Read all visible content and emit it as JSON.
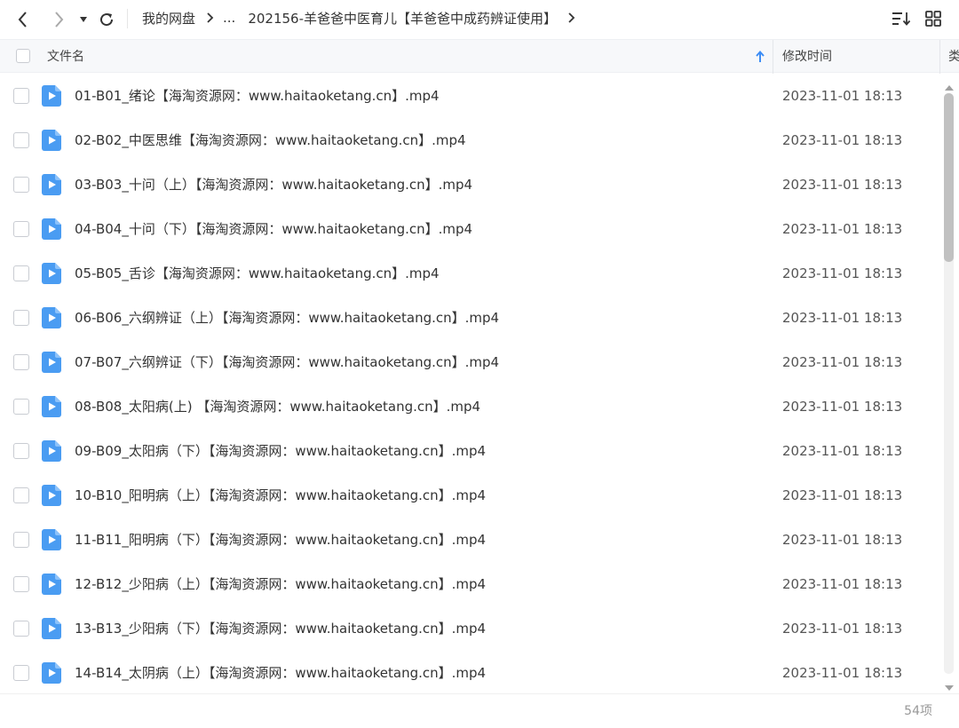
{
  "breadcrumb": {
    "items": [
      "我的网盘",
      "...",
      "202156-羊爸爸中医育儿【羊爸爸中成药辨证使用】"
    ]
  },
  "icons": {
    "back": "chevron-left-icon",
    "forward": "chevron-right-icon",
    "dropdown": "caret-down-icon",
    "refresh": "refresh-icon",
    "sort": "sort-list-icon",
    "grid": "grid-view-icon",
    "file": "video-file-icon"
  },
  "colors": {
    "accent": "#3d8df5",
    "file_icon": "#4a9cf2"
  },
  "header": {
    "name_label": "文件名",
    "time_label": "修改时间",
    "type_label": "类"
  },
  "files": [
    {
      "name": "01-B01_绪论【海淘资源网：www.haitaoketang.cn】.mp4",
      "time": "2023-11-01 18:13"
    },
    {
      "name": "02-B02_中医思维【海淘资源网：www.haitaoketang.cn】.mp4",
      "time": "2023-11-01 18:13"
    },
    {
      "name": "03-B03_十问（上）【海淘资源网：www.haitaoketang.cn】.mp4",
      "time": "2023-11-01 18:13"
    },
    {
      "name": "04-B04_十问（下）【海淘资源网：www.haitaoketang.cn】.mp4",
      "time": "2023-11-01 18:13"
    },
    {
      "name": "05-B05_舌诊【海淘资源网：www.haitaoketang.cn】.mp4",
      "time": "2023-11-01 18:13"
    },
    {
      "name": "06-B06_六纲辨证（上）【海淘资源网：www.haitaoketang.cn】.mp4",
      "time": "2023-11-01 18:13"
    },
    {
      "name": "07-B07_六纲辨证（下）【海淘资源网：www.haitaoketang.cn】.mp4",
      "time": "2023-11-01 18:13"
    },
    {
      "name": "08-B08_太阳病(上) 【海淘资源网：www.haitaoketang.cn】.mp4",
      "time": "2023-11-01 18:13"
    },
    {
      "name": "09-B09_太阳病（下）【海淘资源网：www.haitaoketang.cn】.mp4",
      "time": "2023-11-01 18:13"
    },
    {
      "name": "10-B10_阳明病（上）【海淘资源网：www.haitaoketang.cn】.mp4",
      "time": "2023-11-01 18:13"
    },
    {
      "name": "11-B11_阳明病（下）【海淘资源网：www.haitaoketang.cn】.mp4",
      "time": "2023-11-01 18:13"
    },
    {
      "name": "12-B12_少阳病（上）【海淘资源网：www.haitaoketang.cn】.mp4",
      "time": "2023-11-01 18:13"
    },
    {
      "name": "13-B13_少阳病（下）【海淘资源网：www.haitaoketang.cn】.mp4",
      "time": "2023-11-01 18:13"
    },
    {
      "name": "14-B14_太阴病（上）【海淘资源网：www.haitaoketang.cn】.mp4",
      "time": "2023-11-01 18:13"
    }
  ],
  "footer": {
    "count": "54项"
  }
}
